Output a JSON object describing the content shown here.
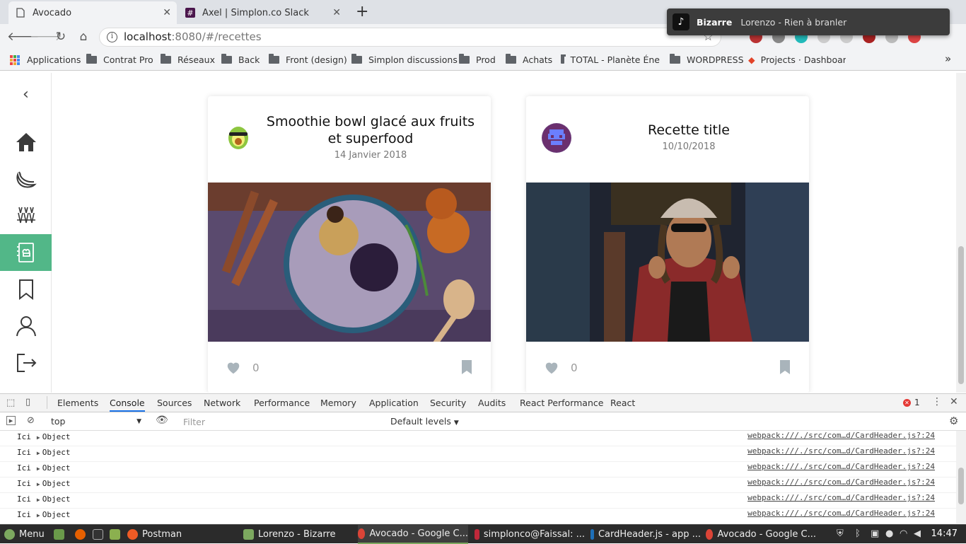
{
  "browser": {
    "tabs": [
      {
        "label": "Avocado",
        "active": true
      },
      {
        "label": "Axel | Simplon.co Slack",
        "active": false
      }
    ],
    "new_tab": "+",
    "address": {
      "host": "localhost",
      "path": ":8080/#/recettes"
    },
    "bookmarks": [
      "Applications",
      "Contrat Pro",
      "Réseaux",
      "Back",
      "Front (design)",
      "Simplon discussions",
      "Prod",
      "Achats",
      "TOTAL - Planète Éne",
      "WORDPRESS",
      "Projects · Dashboard"
    ],
    "more_bookmarks": "»"
  },
  "notification": {
    "title": "Bizarre",
    "body": "Lorenzo - Rien à branler"
  },
  "app": {
    "sidebar": {
      "collapse_icon": "‹",
      "items": [
        {
          "icon": "home-icon",
          "active": false
        },
        {
          "icon": "banana-icon",
          "active": false
        },
        {
          "icon": "vegetables-icon",
          "active": false
        },
        {
          "icon": "recipe-book-icon",
          "active": true
        },
        {
          "icon": "bookmark-icon",
          "active": false
        },
        {
          "icon": "user-icon",
          "active": false
        },
        {
          "icon": "logout-icon",
          "active": false
        }
      ]
    },
    "cards": [
      {
        "title": "Smoothie bowl glacé aux fruits et superfood",
        "date": "14 Janvier 2018",
        "likes": "0",
        "avatar": "avocado-avatar"
      },
      {
        "title": "Recette title",
        "date": "10/10/2018",
        "likes": "0",
        "avatar": "pixel-avatar"
      }
    ],
    "accent_color": "#52b788"
  },
  "devtools": {
    "tabs": [
      "Elements",
      "Console",
      "Sources",
      "Network",
      "Performance",
      "Memory",
      "Application",
      "Security",
      "Audits",
      "React Performance",
      "React"
    ],
    "active_tab": "Console",
    "error_count": "1",
    "context": "top",
    "filter_placeholder": "Filter",
    "levels": "Default levels",
    "logs": [
      {
        "prefix": "Ici",
        "object": "Object",
        "source": "webpack:///./src/com…d/CardHeader.js?:24"
      },
      {
        "prefix": "Ici",
        "object": "Object",
        "source": "webpack:///./src/com…d/CardHeader.js?:24"
      },
      {
        "prefix": "Ici",
        "object": "Object",
        "source": "webpack:///./src/com…d/CardHeader.js?:24"
      },
      {
        "prefix": "Ici",
        "object": "Object",
        "source": "webpack:///./src/com…d/CardHeader.js?:24"
      },
      {
        "prefix": "Ici",
        "object": "Object",
        "source": "webpack:///./src/com…d/CardHeader.js?:24"
      },
      {
        "prefix": "Ici",
        "object": "Object",
        "source": "webpack:///./src/com…d/CardHeader.js?:24"
      }
    ]
  },
  "taskbar": {
    "menu": "Menu",
    "tasks": [
      {
        "label": "Postman",
        "open": false
      },
      {
        "label": "Lorenzo - Bizarre",
        "open": false
      },
      {
        "label": "Avocado - Google C...",
        "open": true
      },
      {
        "label": "simplonco@Faissal: ...",
        "open": false
      },
      {
        "label": "CardHeader.js - app ...",
        "open": false
      },
      {
        "label": "Avocado - Google C...",
        "open": false
      }
    ],
    "clock": "14:47"
  }
}
